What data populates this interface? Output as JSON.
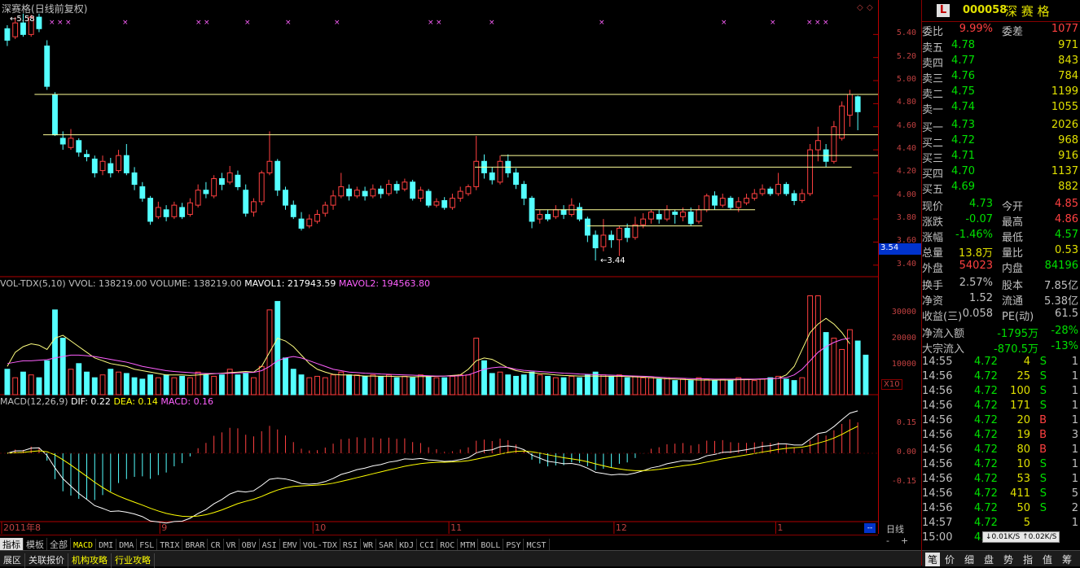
{
  "stock": {
    "name": "深赛格",
    "period": "(日线前复权)",
    "code": "000058",
    "name_spaced": "深 赛 格"
  },
  "price_panel": {
    "high_note": "5.58",
    "low_note": "3.44",
    "y_ticks": [
      "5.40",
      "5.20",
      "5.00",
      "4.80",
      "4.60",
      "4.40",
      "4.20",
      "4.00",
      "3.80",
      "3.60",
      "3.40"
    ],
    "last_value": "3.54",
    "candles": [
      [
        5.45,
        5.35,
        5.48,
        5.3
      ],
      [
        5.38,
        5.5,
        5.55,
        5.36
      ],
      [
        5.5,
        5.4,
        5.58,
        5.38
      ],
      [
        5.4,
        5.55,
        5.57,
        5.38
      ],
      [
        5.55,
        5.45,
        5.58,
        5.42
      ],
      [
        5.3,
        4.95,
        5.35,
        4.92
      ],
      [
        4.88,
        4.53,
        4.9,
        4.52
      ],
      [
        4.5,
        4.45,
        4.56,
        4.4
      ],
      [
        4.42,
        4.5,
        4.58,
        4.4
      ],
      [
        4.48,
        4.38,
        4.5,
        4.34
      ],
      [
        4.36,
        4.34,
        4.4,
        4.3
      ],
      [
        4.32,
        4.2,
        4.35,
        4.16
      ],
      [
        4.22,
        4.3,
        4.35,
        4.18
      ],
      [
        4.28,
        4.2,
        4.33,
        4.16
      ],
      [
        4.22,
        4.35,
        4.4,
        4.2
      ],
      [
        4.35,
        4.2,
        4.45,
        4.18
      ],
      [
        4.2,
        4.1,
        4.25,
        4.05
      ],
      [
        4.08,
        3.98,
        4.12,
        3.95
      ],
      [
        3.98,
        3.78,
        4.0,
        3.75
      ],
      [
        3.82,
        3.9,
        3.95,
        3.8
      ],
      [
        3.88,
        3.82,
        3.92,
        3.78
      ],
      [
        3.82,
        3.92,
        3.95,
        3.8
      ],
      [
        3.9,
        3.82,
        3.94,
        3.8
      ],
      [
        3.84,
        3.94,
        3.98,
        3.82
      ],
      [
        3.92,
        4.05,
        4.1,
        3.9
      ],
      [
        4.05,
        4.02,
        4.12,
        3.98
      ],
      [
        4.0,
        4.15,
        4.18,
        3.98
      ],
      [
        4.15,
        4.1,
        4.2,
        4.05
      ],
      [
        4.12,
        4.2,
        4.26,
        4.1
      ],
      [
        4.18,
        4.08,
        4.22,
        4.05
      ],
      [
        4.05,
        3.85,
        4.1,
        3.82
      ],
      [
        3.86,
        3.95,
        3.98,
        3.82
      ],
      [
        3.95,
        4.2,
        4.22,
        3.92
      ],
      [
        4.2,
        4.3,
        4.56,
        4.18
      ],
      [
        4.3,
        4.05,
        4.32,
        4.0
      ],
      [
        4.05,
        3.92,
        4.08,
        3.88
      ],
      [
        3.92,
        3.82,
        3.96,
        3.8
      ],
      [
        3.8,
        3.72,
        3.86,
        3.7
      ],
      [
        3.74,
        3.8,
        3.84,
        3.72
      ],
      [
        3.78,
        3.84,
        3.88,
        3.76
      ],
      [
        3.85,
        3.92,
        3.95,
        3.82
      ],
      [
        3.92,
        4.0,
        4.05,
        3.88
      ],
      [
        4.0,
        4.08,
        4.2,
        3.98
      ],
      [
        4.06,
        4.0,
        4.1,
        3.96
      ],
      [
        4.0,
        4.05,
        4.08,
        3.98
      ],
      [
        4.04,
        4.0,
        4.08,
        3.96
      ],
      [
        4.0,
        4.06,
        4.1,
        3.98
      ],
      [
        4.06,
        4.02,
        4.09,
        3.98
      ],
      [
        4.02,
        4.1,
        4.14,
        4.0
      ],
      [
        4.1,
        4.05,
        4.13,
        4.02
      ],
      [
        4.06,
        4.12,
        4.15,
        4.04
      ],
      [
        4.12,
        3.98,
        4.14,
        3.96
      ],
      [
        3.98,
        4.05,
        4.08,
        3.95
      ],
      [
        4.04,
        3.92,
        4.06,
        3.9
      ],
      [
        3.92,
        3.95,
        3.98,
        3.9
      ],
      [
        3.96,
        3.9,
        3.99,
        3.88
      ],
      [
        3.9,
        3.98,
        4.02,
        3.88
      ],
      [
        3.98,
        4.04,
        4.08,
        3.95
      ],
      [
        4.02,
        4.08,
        4.1,
        4.0
      ],
      [
        4.08,
        4.3,
        4.52,
        4.05
      ],
      [
        4.3,
        4.2,
        4.36,
        4.15
      ],
      [
        4.2,
        4.14,
        4.25,
        4.1
      ],
      [
        4.12,
        4.3,
        4.35,
        4.1
      ],
      [
        4.3,
        4.2,
        4.36,
        4.16
      ],
      [
        4.2,
        4.1,
        4.24,
        4.06
      ],
      [
        4.1,
        3.98,
        4.13,
        3.92
      ],
      [
        3.98,
        3.78,
        4.0,
        3.72
      ],
      [
        3.8,
        3.84,
        3.88,
        3.76
      ],
      [
        3.84,
        3.8,
        3.88,
        3.78
      ],
      [
        3.82,
        3.88,
        3.92,
        3.8
      ],
      [
        3.88,
        3.84,
        3.92,
        3.8
      ],
      [
        3.84,
        3.92,
        3.98,
        3.82
      ],
      [
        3.9,
        3.8,
        3.94,
        3.78
      ],
      [
        3.8,
        3.66,
        3.82,
        3.6
      ],
      [
        3.66,
        3.55,
        3.7,
        3.44
      ],
      [
        3.56,
        3.66,
        3.8,
        3.52
      ],
      [
        3.66,
        3.62,
        3.7,
        3.55
      ],
      [
        3.62,
        3.72,
        3.74,
        3.48
      ],
      [
        3.72,
        3.64,
        3.76,
        3.6
      ],
      [
        3.64,
        3.75,
        3.82,
        3.62
      ],
      [
        3.75,
        3.8,
        3.85,
        3.72
      ],
      [
        3.8,
        3.86,
        3.88,
        3.76
      ],
      [
        3.84,
        3.8,
        3.88,
        3.76
      ],
      [
        3.8,
        3.88,
        3.92,
        3.78
      ],
      [
        3.86,
        3.84,
        3.88,
        3.76
      ],
      [
        3.82,
        3.86,
        3.9,
        3.78
      ],
      [
        3.86,
        3.76,
        3.9,
        3.74
      ],
      [
        3.78,
        3.88,
        3.92,
        3.76
      ],
      [
        3.88,
        4.0,
        4.02,
        3.86
      ],
      [
        4.0,
        3.92,
        4.04,
        3.88
      ],
      [
        3.92,
        3.98,
        4.02,
        3.9
      ],
      [
        3.98,
        3.9,
        4.0,
        3.88
      ],
      [
        3.9,
        3.95,
        3.99,
        3.86
      ],
      [
        3.94,
        3.98,
        4.02,
        3.92
      ],
      [
        3.98,
        4.02,
        4.06,
        3.96
      ],
      [
        4.02,
        4.06,
        4.1,
        4.0
      ],
      [
        4.06,
        4.02,
        4.08,
        4.0
      ],
      [
        4.02,
        4.1,
        4.2,
        4.0
      ],
      [
        4.1,
        4.02,
        4.12,
        4.0
      ],
      [
        4.02,
        3.96,
        4.05,
        3.92
      ],
      [
        3.96,
        4.02,
        4.06,
        3.94
      ],
      [
        4.02,
        4.4,
        4.45,
        4.0
      ],
      [
        4.4,
        4.48,
        4.6,
        4.3
      ],
      [
        4.4,
        4.3,
        4.45,
        4.25
      ],
      [
        4.3,
        4.6,
        4.65,
        4.28
      ],
      [
        4.5,
        4.78,
        4.82,
        4.48
      ],
      [
        4.7,
        4.88,
        4.92,
        4.6
      ],
      [
        4.86,
        4.73,
        4.87,
        4.57
      ]
    ],
    "resistance_lines": [
      {
        "price": 4.88
      },
      {
        "price": 4.53
      },
      {
        "price": 4.35
      },
      {
        "price": 4.25
      },
      {
        "price": 3.88
      },
      {
        "price": 3.74
      }
    ]
  },
  "volume_panel": {
    "title_name": "VOL-TDX(5,10)",
    "vvol": "VVOL: 138219.00",
    "volume": "VOLUME: 138219.00",
    "mavol1": "MAVOL1: 217943.59",
    "mavol2": "MAVOL2: 194563.80",
    "y_ticks": [
      "30000",
      "20000",
      "10000"
    ],
    "unit": "X10",
    "bars": [
      90,
      60,
      80,
      70,
      60,
      120,
      300,
      200,
      90,
      110,
      80,
      60,
      70,
      90,
      80,
      75,
      60,
      55,
      70,
      60,
      70,
      60,
      65,
      60,
      80,
      70,
      65,
      70,
      90,
      70,
      75,
      60,
      100,
      300,
      330,
      130,
      90,
      70,
      60,
      65,
      60,
      70,
      80,
      70,
      70,
      65,
      70,
      65,
      70,
      60,
      65,
      60,
      70,
      65,
      60,
      60,
      65,
      70,
      70,
      200,
      120,
      75,
      80,
      70,
      65,
      70,
      80,
      70,
      65,
      60,
      60,
      65,
      60,
      70,
      80,
      70,
      65,
      70,
      60,
      65,
      60,
      60,
      55,
      60,
      50,
      55,
      50,
      60,
      55,
      50,
      55,
      50,
      60,
      55,
      50,
      55,
      60,
      65,
      55,
      50,
      60,
      350,
      350,
      220,
      200,
      160,
      230,
      190,
      140
    ],
    "ma1": [
      100,
      150,
      170,
      180,
      175,
      160,
      200,
      210,
      190,
      170,
      150,
      130,
      120,
      110,
      105,
      100,
      90,
      85,
      80,
      75,
      70,
      70,
      70,
      68,
      70,
      72,
      74,
      76,
      78,
      80,
      82,
      80,
      100,
      150,
      200,
      190,
      170,
      140,
      110,
      90,
      80,
      72,
      70,
      70,
      68,
      66,
      66,
      65,
      65,
      64,
      64,
      63,
      64,
      64,
      65,
      66,
      68,
      70,
      90,
      120,
      130,
      125,
      110,
      95,
      85,
      80,
      78,
      75,
      73,
      70,
      68,
      67,
      66,
      66,
      66,
      65,
      65,
      65,
      64,
      63,
      62,
      60,
      58,
      56,
      55,
      54,
      53,
      52,
      52,
      52,
      52,
      52,
      53,
      53,
      54,
      55,
      56,
      58,
      70,
      100,
      160,
      220,
      250,
      270,
      250,
      220,
      180
    ],
    "ma2": [
      110,
      115,
      120,
      120,
      122,
      124,
      130,
      135,
      140,
      140,
      138,
      135,
      130,
      125,
      120,
      115,
      108,
      100,
      95,
      90,
      85,
      82,
      80,
      78,
      76,
      75,
      75,
      75,
      76,
      77,
      78,
      79,
      85,
      100,
      120,
      130,
      135,
      130,
      120,
      110,
      100,
      90,
      85,
      80,
      78,
      76,
      75,
      73,
      72,
      71,
      70,
      69,
      68,
      67,
      66,
      66,
      66,
      67,
      70,
      80,
      90,
      95,
      98,
      96,
      90,
      86,
      84,
      82,
      80,
      78,
      76,
      75,
      73,
      72,
      71,
      70,
      69,
      68,
      67,
      66,
      65,
      64,
      62,
      60,
      59,
      58,
      57,
      56,
      56,
      55,
      55,
      55,
      55,
      55,
      55,
      56,
      57,
      58,
      60,
      70,
      90,
      120,
      150,
      170,
      185,
      195,
      200
    ]
  },
  "macd_panel": {
    "title_name": "MACD(12,26,9)",
    "dif": "DIF: 0.22",
    "dea": "DEA: 0.14",
    "macd": "MACD: 0.16",
    "y_ticks": [
      "0.15",
      "0.00",
      "-0.15"
    ]
  },
  "x_axis_labels": [
    {
      "label": "2011年8",
      "pos": 0.0
    },
    {
      "label": "9",
      "pos": 0.184
    },
    {
      "label": "10",
      "pos": 0.362
    },
    {
      "label": "11",
      "pos": 0.52
    },
    {
      "label": "12",
      "pos": 0.712
    },
    {
      "label": "1",
      "pos": 0.9
    }
  ],
  "indicator_tabs": [
    "指标",
    "模板",
    "全部",
    "MACD",
    "DMI",
    "DMA",
    "FSL",
    "TRIX",
    "BRAR",
    "CR",
    "VR",
    "OBV",
    "ASI",
    "EMV",
    "VOL-TDX",
    "RSI",
    "WR",
    "SAR",
    "KDJ",
    "CCI",
    "ROC",
    "MTM",
    "BOLL",
    "PSY",
    "MCST"
  ],
  "bottom_tabs": [
    "展区",
    "关联报价",
    "机构攻略",
    "行业攻略"
  ],
  "right_nav": [
    "日线",
    "-",
    "+"
  ],
  "quote": {
    "weibi_label": "委比",
    "weibi": "9.99%",
    "weicha_label": "委差",
    "weicha": "1077",
    "asks": [
      {
        "label": "卖五",
        "price": "4.78",
        "vol": "971"
      },
      {
        "label": "卖四",
        "price": "4.77",
        "vol": "843"
      },
      {
        "label": "卖三",
        "price": "4.76",
        "vol": "784"
      },
      {
        "label": "卖二",
        "price": "4.75",
        "vol": "1199"
      },
      {
        "label": "卖一",
        "price": "4.74",
        "vol": "1055"
      }
    ],
    "bids": [
      {
        "label": "买一",
        "price": "4.73",
        "vol": "2026"
      },
      {
        "label": "买二",
        "price": "4.72",
        "vol": "968"
      },
      {
        "label": "买三",
        "price": "4.71",
        "vol": "916"
      },
      {
        "label": "买四",
        "price": "4.70",
        "vol": "1137"
      },
      {
        "label": "买五",
        "price": "4.69",
        "vol": "882"
      }
    ],
    "stats": [
      {
        "l1": "现价",
        "v1": "4.73",
        "c1": "#00e000",
        "l2": "今开",
        "v2": "4.85",
        "c2": "#ff4040"
      },
      {
        "l1": "涨跌",
        "v1": "-0.07",
        "c1": "#00e000",
        "l2": "最高",
        "v2": "4.86",
        "c2": "#ff4040"
      },
      {
        "l1": "涨幅",
        "v1": "-1.46%",
        "c1": "#00e000",
        "l2": "最低",
        "v2": "4.57",
        "c2": "#00e000"
      },
      {
        "l1": "总量",
        "v1": "13.8万",
        "c1": "#e0e000",
        "l2": "量比",
        "v2": "0.53",
        "c2": "#e0e000"
      },
      {
        "l1": "外盘",
        "v1": "54023",
        "c1": "#ff4040",
        "l2": "内盘",
        "v2": "84196",
        "c2": "#00e000"
      }
    ],
    "info": [
      {
        "l1": "换手",
        "v1": "2.57%",
        "l2": "股本",
        "v2": "7.85亿"
      },
      {
        "l1": "净资",
        "v1": "1.52",
        "l2": "流通",
        "v2": "5.38亿"
      },
      {
        "l1": "收益(三)",
        "v1": "0.058",
        "l2": "PE(动)",
        "v2": "61.5"
      }
    ],
    "flow": [
      {
        "label": "净流入额",
        "v1": "-1795万",
        "v2": "-28%"
      },
      {
        "label": "大宗流入",
        "v1": "-870.5万",
        "v2": "-13%"
      }
    ],
    "ticks": [
      {
        "t": "14:55",
        "p": "4.72",
        "v": "4",
        "d": "S",
        "n": "1"
      },
      {
        "t": "14:56",
        "p": "4.72",
        "v": "25",
        "d": "S",
        "n": "1"
      },
      {
        "t": "14:56",
        "p": "4.72",
        "v": "100",
        "d": "S",
        "n": "1"
      },
      {
        "t": "14:56",
        "p": "4.72",
        "v": "171",
        "d": "S",
        "n": "1"
      },
      {
        "t": "14:56",
        "p": "4.72",
        "v": "20",
        "d": "B",
        "n": "1"
      },
      {
        "t": "14:56",
        "p": "4.72",
        "v": "19",
        "d": "B",
        "n": "3"
      },
      {
        "t": "14:56",
        "p": "4.72",
        "v": "80",
        "d": "B",
        "n": "1"
      },
      {
        "t": "14:56",
        "p": "4.72",
        "v": "10",
        "d": "S",
        "n": "1"
      },
      {
        "t": "14:56",
        "p": "4.72",
        "v": "53",
        "d": "S",
        "n": "1"
      },
      {
        "t": "14:56",
        "p": "4.72",
        "v": "411",
        "d": "S",
        "n": "5"
      },
      {
        "t": "14:56",
        "p": "4.72",
        "v": "50",
        "d": "S",
        "n": "2"
      },
      {
        "t": "14:57",
        "p": "4.72",
        "v": "5",
        "d": "",
        "n": "1"
      },
      {
        "t": "15:00",
        "p": "4.",
        "v": "",
        "d": "",
        "n": ""
      }
    ],
    "net_speed": "↓0.01K/S  ↑0.02K/S",
    "right_bottom_tabs": [
      "笔",
      "价",
      "细",
      "盘",
      "势",
      "指",
      "值",
      "筹"
    ]
  },
  "colors": {
    "up": "#ff4040",
    "down": "#54ffff",
    "grid": "#b00000",
    "ma_white": "#ffffff",
    "ma_yellow": "#ffff80",
    "ma_pink": "#ff60ff",
    "line": "#ffff99"
  }
}
